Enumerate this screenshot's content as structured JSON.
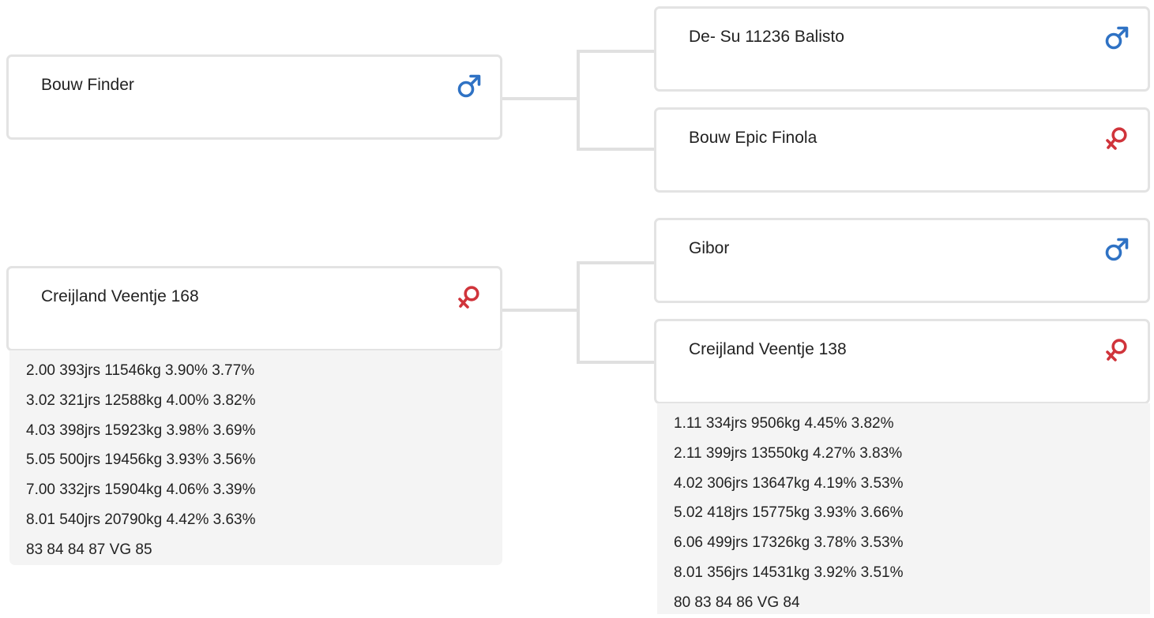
{
  "colors": {
    "male": "#2f72c4",
    "female": "#d0343b",
    "border": "#e3e3e3",
    "stats_bg": "#f4f4f4"
  },
  "animals": {
    "sire": {
      "name": "Bouw Finder",
      "sex_icon": "male-symbol-icon",
      "sire": {
        "name": "De- Su 11236 Balisto",
        "sex_icon": "male-symbol-icon"
      },
      "dam": {
        "name": "Bouw Epic Finola",
        "sex_icon": "female-symbol-icon"
      }
    },
    "dam": {
      "name": "Creijland Veentje 168",
      "sex_icon": "female-symbol-icon",
      "stats": [
        "2.00 393jrs 11546kg 3.90% 3.77%",
        "3.02 321jrs 12588kg 4.00% 3.82%",
        "4.03 398jrs 15923kg 3.98% 3.69%",
        "5.05 500jrs 19456kg 3.93% 3.56%",
        "7.00 332jrs 15904kg 4.06% 3.39%",
        "8.01 540jrs 20790kg 4.42% 3.63%",
        "83 84 84 87 VG 85"
      ],
      "sire": {
        "name": "Gibor",
        "sex_icon": "male-symbol-icon"
      },
      "dam": {
        "name": "Creijland Veentje 138",
        "sex_icon": "female-symbol-icon",
        "stats": [
          "1.11 334jrs 9506kg 4.45% 3.82%",
          "2.11 399jrs 13550kg 4.27% 3.83%",
          "4.02 306jrs 13647kg 4.19% 3.53%",
          "5.02 418jrs 15775kg 3.93% 3.66%",
          "6.06 499jrs 17326kg 3.78% 3.53%",
          "8.01 356jrs 14531kg 3.92% 3.51%",
          "80 83 84 86 VG 84"
        ]
      }
    }
  }
}
